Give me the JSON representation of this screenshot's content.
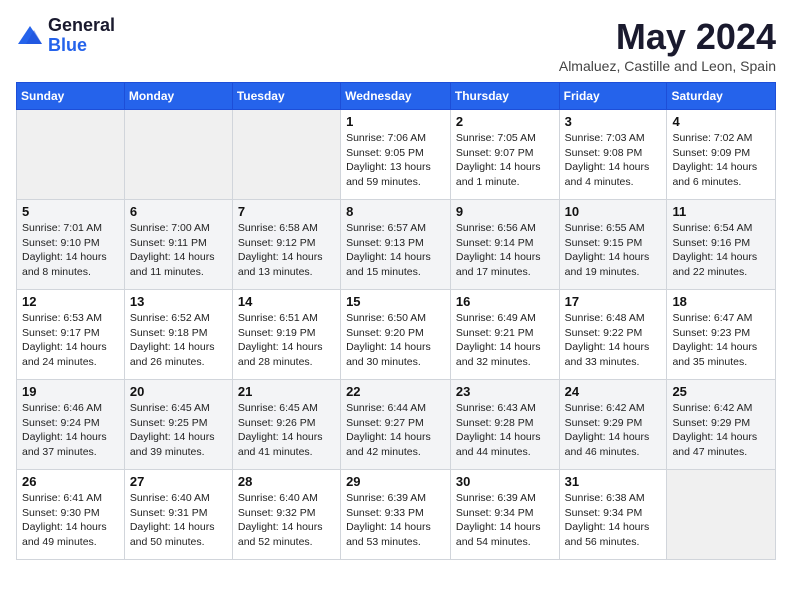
{
  "header": {
    "logo": {
      "line1": "General",
      "line2": "Blue"
    },
    "month_title": "May 2024",
    "subtitle": "Almaluez, Castille and Leon, Spain"
  },
  "days_of_week": [
    "Sunday",
    "Monday",
    "Tuesday",
    "Wednesday",
    "Thursday",
    "Friday",
    "Saturday"
  ],
  "weeks": [
    [
      {
        "day": "",
        "info": ""
      },
      {
        "day": "",
        "info": ""
      },
      {
        "day": "",
        "info": ""
      },
      {
        "day": "1",
        "info": "Sunrise: 7:06 AM\nSunset: 9:05 PM\nDaylight: 13 hours\nand 59 minutes."
      },
      {
        "day": "2",
        "info": "Sunrise: 7:05 AM\nSunset: 9:07 PM\nDaylight: 14 hours\nand 1 minute."
      },
      {
        "day": "3",
        "info": "Sunrise: 7:03 AM\nSunset: 9:08 PM\nDaylight: 14 hours\nand 4 minutes."
      },
      {
        "day": "4",
        "info": "Sunrise: 7:02 AM\nSunset: 9:09 PM\nDaylight: 14 hours\nand 6 minutes."
      }
    ],
    [
      {
        "day": "5",
        "info": "Sunrise: 7:01 AM\nSunset: 9:10 PM\nDaylight: 14 hours\nand 8 minutes."
      },
      {
        "day": "6",
        "info": "Sunrise: 7:00 AM\nSunset: 9:11 PM\nDaylight: 14 hours\nand 11 minutes."
      },
      {
        "day": "7",
        "info": "Sunrise: 6:58 AM\nSunset: 9:12 PM\nDaylight: 14 hours\nand 13 minutes."
      },
      {
        "day": "8",
        "info": "Sunrise: 6:57 AM\nSunset: 9:13 PM\nDaylight: 14 hours\nand 15 minutes."
      },
      {
        "day": "9",
        "info": "Sunrise: 6:56 AM\nSunset: 9:14 PM\nDaylight: 14 hours\nand 17 minutes."
      },
      {
        "day": "10",
        "info": "Sunrise: 6:55 AM\nSunset: 9:15 PM\nDaylight: 14 hours\nand 19 minutes."
      },
      {
        "day": "11",
        "info": "Sunrise: 6:54 AM\nSunset: 9:16 PM\nDaylight: 14 hours\nand 22 minutes."
      }
    ],
    [
      {
        "day": "12",
        "info": "Sunrise: 6:53 AM\nSunset: 9:17 PM\nDaylight: 14 hours\nand 24 minutes."
      },
      {
        "day": "13",
        "info": "Sunrise: 6:52 AM\nSunset: 9:18 PM\nDaylight: 14 hours\nand 26 minutes."
      },
      {
        "day": "14",
        "info": "Sunrise: 6:51 AM\nSunset: 9:19 PM\nDaylight: 14 hours\nand 28 minutes."
      },
      {
        "day": "15",
        "info": "Sunrise: 6:50 AM\nSunset: 9:20 PM\nDaylight: 14 hours\nand 30 minutes."
      },
      {
        "day": "16",
        "info": "Sunrise: 6:49 AM\nSunset: 9:21 PM\nDaylight: 14 hours\nand 32 minutes."
      },
      {
        "day": "17",
        "info": "Sunrise: 6:48 AM\nSunset: 9:22 PM\nDaylight: 14 hours\nand 33 minutes."
      },
      {
        "day": "18",
        "info": "Sunrise: 6:47 AM\nSunset: 9:23 PM\nDaylight: 14 hours\nand 35 minutes."
      }
    ],
    [
      {
        "day": "19",
        "info": "Sunrise: 6:46 AM\nSunset: 9:24 PM\nDaylight: 14 hours\nand 37 minutes."
      },
      {
        "day": "20",
        "info": "Sunrise: 6:45 AM\nSunset: 9:25 PM\nDaylight: 14 hours\nand 39 minutes."
      },
      {
        "day": "21",
        "info": "Sunrise: 6:45 AM\nSunset: 9:26 PM\nDaylight: 14 hours\nand 41 minutes."
      },
      {
        "day": "22",
        "info": "Sunrise: 6:44 AM\nSunset: 9:27 PM\nDaylight: 14 hours\nand 42 minutes."
      },
      {
        "day": "23",
        "info": "Sunrise: 6:43 AM\nSunset: 9:28 PM\nDaylight: 14 hours\nand 44 minutes."
      },
      {
        "day": "24",
        "info": "Sunrise: 6:42 AM\nSunset: 9:29 PM\nDaylight: 14 hours\nand 46 minutes."
      },
      {
        "day": "25",
        "info": "Sunrise: 6:42 AM\nSunset: 9:29 PM\nDaylight: 14 hours\nand 47 minutes."
      }
    ],
    [
      {
        "day": "26",
        "info": "Sunrise: 6:41 AM\nSunset: 9:30 PM\nDaylight: 14 hours\nand 49 minutes."
      },
      {
        "day": "27",
        "info": "Sunrise: 6:40 AM\nSunset: 9:31 PM\nDaylight: 14 hours\nand 50 minutes."
      },
      {
        "day": "28",
        "info": "Sunrise: 6:40 AM\nSunset: 9:32 PM\nDaylight: 14 hours\nand 52 minutes."
      },
      {
        "day": "29",
        "info": "Sunrise: 6:39 AM\nSunset: 9:33 PM\nDaylight: 14 hours\nand 53 minutes."
      },
      {
        "day": "30",
        "info": "Sunrise: 6:39 AM\nSunset: 9:34 PM\nDaylight: 14 hours\nand 54 minutes."
      },
      {
        "day": "31",
        "info": "Sunrise: 6:38 AM\nSunset: 9:34 PM\nDaylight: 14 hours\nand 56 minutes."
      },
      {
        "day": "",
        "info": ""
      }
    ]
  ]
}
